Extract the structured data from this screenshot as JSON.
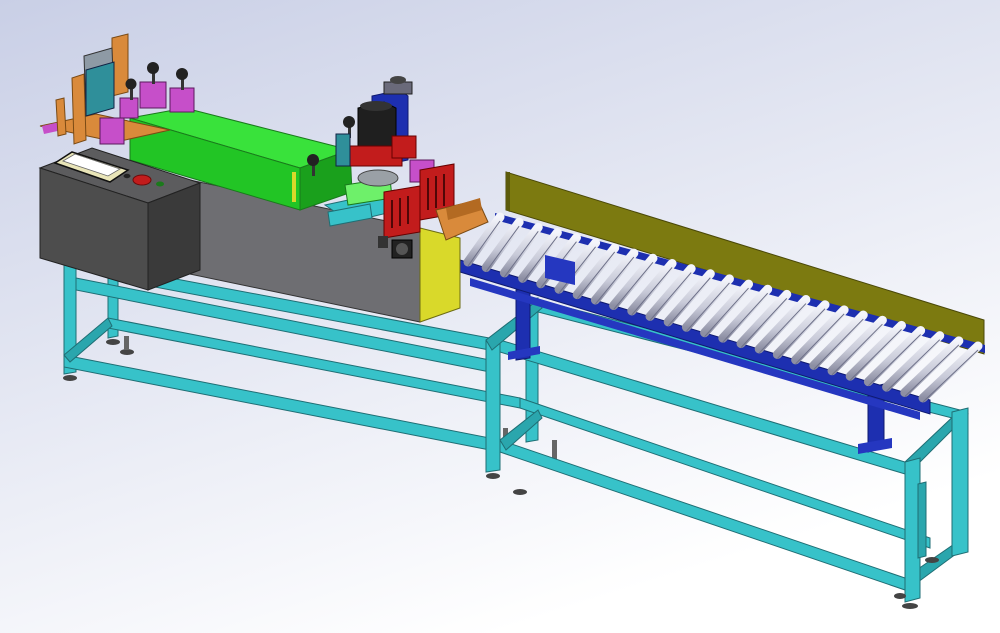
{
  "colors": {
    "background_top": "#c9cfe6",
    "background_bottom": "#ffffff",
    "frame": "#37c2c9",
    "frame_dark": "#1f8f97",
    "cabinet": "#4d4d4d",
    "cabinet_side": "#3a3a3a",
    "body_grey": "#6e6e72",
    "green_cover": "#39e23b",
    "green_dark": "#22a825",
    "conveyor_blue": "#1d2fb0",
    "roller": "#d7d9e6",
    "guide_plate": "#7c7a10",
    "magenta": "#c64fc9",
    "orange": "#d98a3b",
    "red": "#c21c1c",
    "yellow": "#d9d92a",
    "touch_screen": "#e9e5b8",
    "motor_black": "#1f1f1f"
  },
  "icons": {
    "emergency_stop": "emergency-stop-icon",
    "fan_vent": "fan-vent-icon",
    "touch_screen": "touch-screen-icon"
  }
}
